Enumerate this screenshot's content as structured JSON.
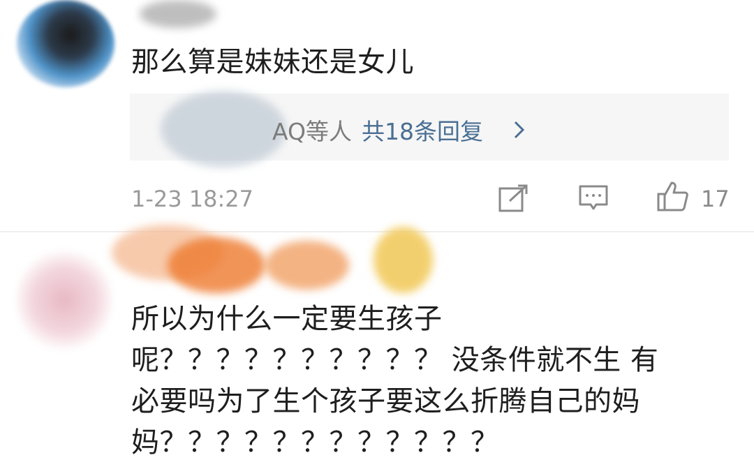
{
  "comment1": {
    "text": "那么算是妹妹还是女儿",
    "reply_users": "AQ等人",
    "reply_count_label": "共18条回复",
    "timestamp": "1-23 18:27",
    "likes": "17"
  },
  "comment2": {
    "lines": [
      "所以为什么一定要生孩子",
      "呢？？？？？？？？？？ 没条件就不生 有",
      "必要吗为了生个孩子要这么折腾自己的妈",
      "妈？？？？？？？？？？？？"
    ]
  },
  "icons": {
    "share": "share-icon",
    "reply": "comment-icon",
    "like": "thumbs-up-icon",
    "chevron": "chevron-right-icon"
  },
  "colors": {
    "link": "#4a6f93",
    "meta": "#9a9a9a",
    "reply_bg": "#f6f6f6"
  }
}
